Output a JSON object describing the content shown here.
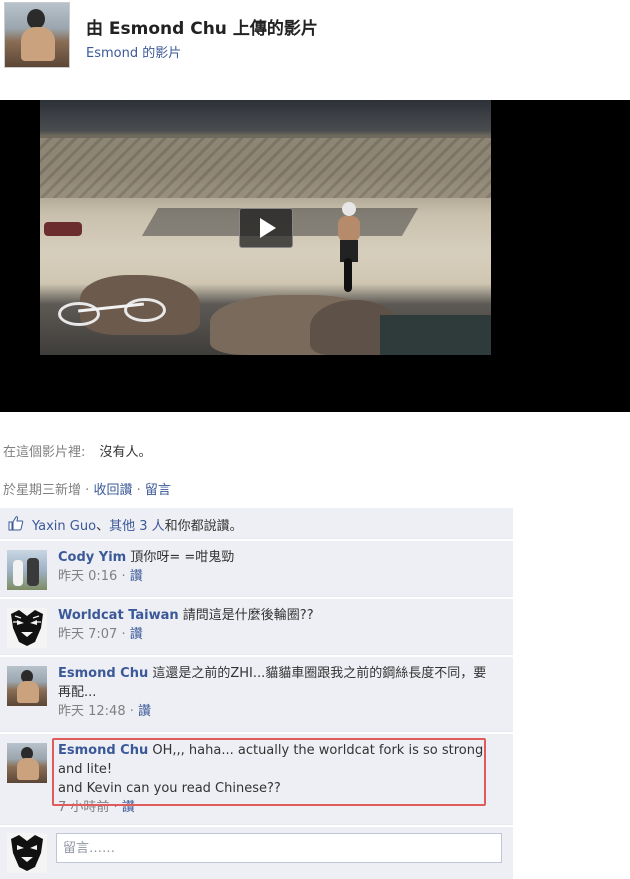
{
  "header": {
    "title": "由 Esmond Chu 上傳的影片",
    "subtitle": "Esmond 的影片"
  },
  "video": {
    "play_icon": "play-icon"
  },
  "tagged": {
    "label": "在這個影片裡:",
    "value": "沒有人。"
  },
  "meta": {
    "added": "於星期三新增",
    "unlike": "收回讚",
    "comment": "留言"
  },
  "likes": {
    "icon": "thumbs-up-icon",
    "name": "Yaxin Guo",
    "separator": "、",
    "others": "其他 3 人",
    "suffix": "和你都說讚。"
  },
  "comments": [
    {
      "author": "Cody Yim",
      "text": "頂你呀= =咁鬼勁",
      "time": "昨天 0:16",
      "action": "讚"
    },
    {
      "author": "Worldcat Taiwan",
      "text": "請問這是什麼後輪圈??",
      "time": "昨天 7:07",
      "action": "讚"
    },
    {
      "author": "Esmond Chu",
      "text": "這還是之前的ZHI...貓貓車圈跟我之前的鋼絲長度不同，要再配...",
      "time": "昨天 12:48",
      "action": "讚"
    },
    {
      "author": "Esmond Chu",
      "text": "OH,,, haha... actually the worldcat fork is so strong and lite!",
      "text2": "and Kevin can you read Chinese??",
      "time": "7 小時前",
      "action": "讚"
    }
  ],
  "composer": {
    "placeholder": "留言……"
  },
  "colors": {
    "link": "#3b5998",
    "panel_bg": "#edeff4",
    "highlight": "#e05b5b"
  }
}
